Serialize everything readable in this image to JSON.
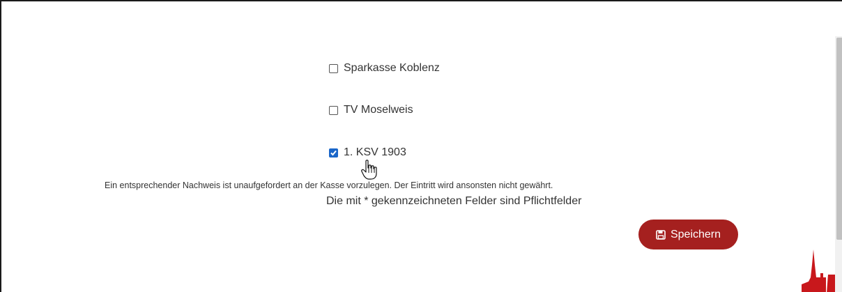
{
  "options": [
    {
      "label": "Sparkasse Koblenz",
      "checked": false
    },
    {
      "label": "TV Moselweis",
      "checked": false
    },
    {
      "label": "1. KSV 1903",
      "checked": true
    }
  ],
  "notice": "Ein entsprechender Nachweis ist unaufgefordert an der Kasse vorzulegen. Der Eintritt wird ansonsten nicht gewährt.",
  "required_note": "Die mit * gekennzeichneten Felder sind Pflichtfelder",
  "save_button": {
    "label": "Speichern",
    "icon": "floppy-disk-icon"
  },
  "colors": {
    "accent": "#a5201f",
    "checkbox_checked": "#1a66c9",
    "text": "#333333"
  }
}
